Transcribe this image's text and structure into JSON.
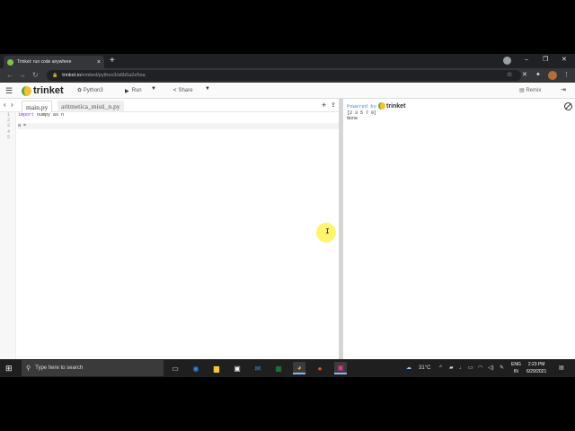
{
  "browser": {
    "tab_title": "Trinket: run code anywhere",
    "url_host": "trinket.io",
    "url_path": "/embed/python3/a6b5a2e5ea",
    "win_min": "–",
    "win_max": "❐",
    "win_close": "✕"
  },
  "trinket": {
    "brand": "trinket",
    "language": "Python3",
    "run_label": "Run",
    "share_label": "Share",
    "remix_label": "Remix",
    "files": [
      "main.py",
      "aritmetica_misti_n.py"
    ],
    "code_lines": [
      {
        "num": "1",
        "kw": "import",
        "rest": " numpy as n"
      },
      {
        "num": "2",
        "kw": "",
        "rest": ""
      },
      {
        "num": "3",
        "kw": "",
        "rest": "a = "
      },
      {
        "num": "4",
        "kw": "",
        "rest": ""
      },
      {
        "num": "5",
        "kw": "",
        "rest": ""
      }
    ],
    "powered_by": "Powered by",
    "output_lines": [
      "[2 3 5 7 9]",
      "None"
    ]
  },
  "taskbar": {
    "search_placeholder": "Type here to search",
    "temperature": "31°C",
    "lang_top": "ENG",
    "lang_bottom": "IN",
    "time": "2:23 PM",
    "date": "6/29/2021"
  },
  "colors": {
    "trinket_yellow": "#f2c230",
    "trinket_green": "#67a539",
    "powered_blue": "#4a8ad8",
    "cursor_highlight": "#fff03c"
  }
}
